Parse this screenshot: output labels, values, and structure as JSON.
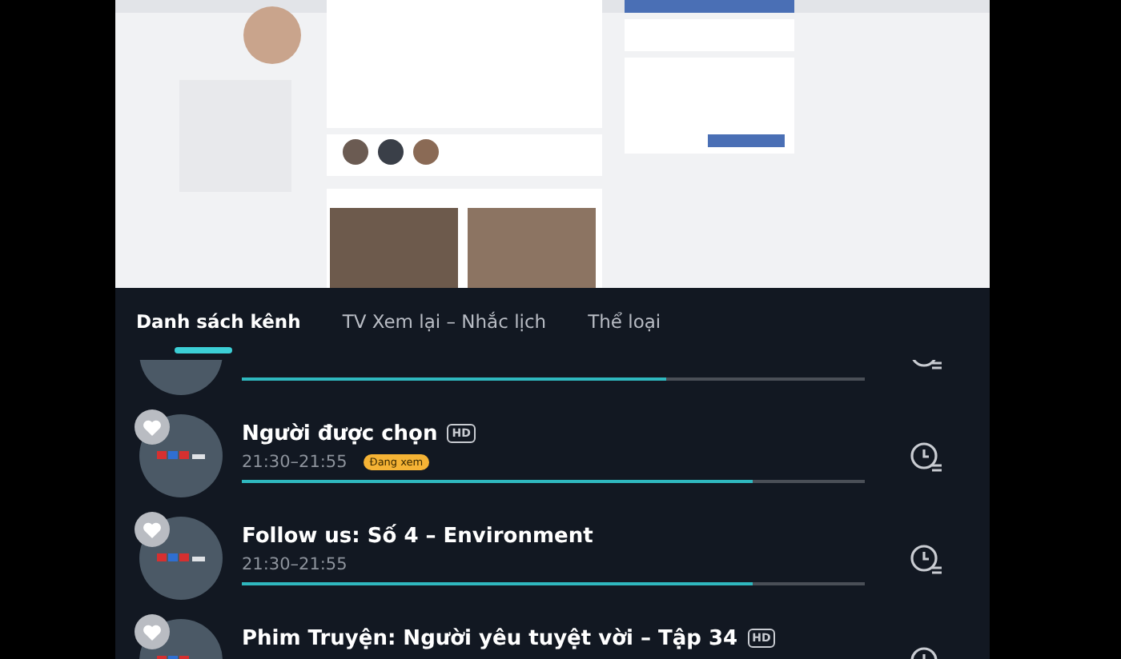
{
  "tabs": [
    {
      "label": "Danh sách kênh",
      "selected": true
    },
    {
      "label": "TV Xem lại – Nhắc lịch",
      "selected": false
    },
    {
      "label": "Thể loại",
      "selected": false
    }
  ],
  "programs": [
    {
      "level": 0.68
    },
    {
      "title": "Người được chọn",
      "quality": "HD",
      "time": "21:30–21:55",
      "badge": "Đang xem",
      "level": 0.82
    },
    {
      "title": "Follow us: Số 4 – Environment",
      "time": "21:30–21:55",
      "level": 0.82
    },
    {
      "title": "Phim Truyện: Người yêu tuyệt vời – Tập 34",
      "quality": "HD"
    }
  ]
}
